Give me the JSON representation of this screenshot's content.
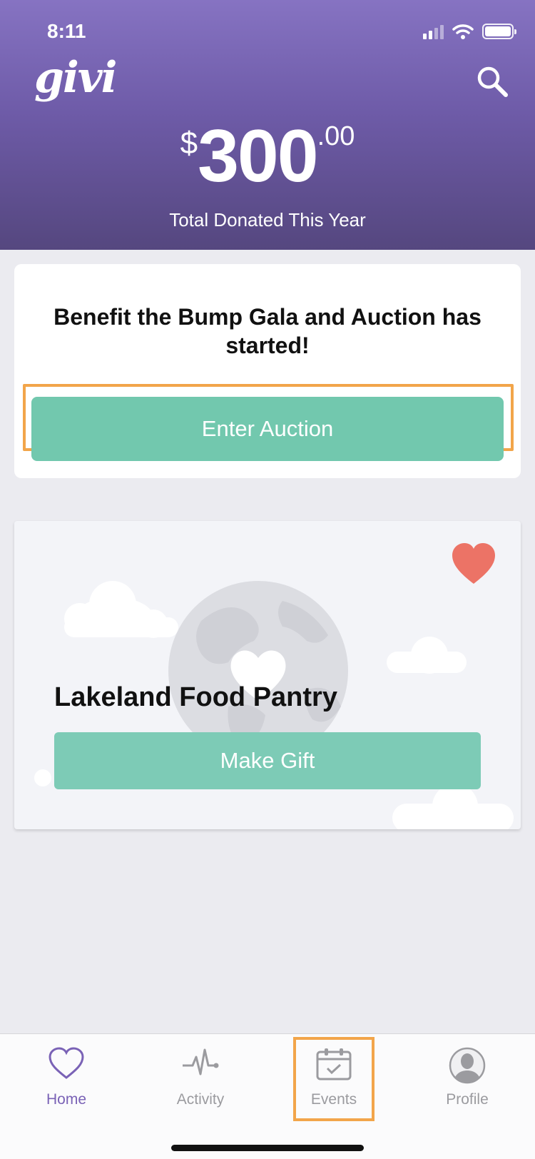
{
  "status_bar": {
    "time": "8:11"
  },
  "header": {
    "logo": "givi",
    "currency_symbol": "$",
    "amount_whole": "300",
    "amount_cents": ".00",
    "total_label": "Total Donated This Year"
  },
  "notice": {
    "title": "Benefit the Bump Gala and Auction has started!",
    "button_label": "Enter Auction"
  },
  "charity": {
    "name": "Lakeland Food Pantry",
    "button_label": "Make Gift",
    "favorite_icon": "heart-icon",
    "favorite_color": "#ec7366"
  },
  "tabbar": {
    "tabs": [
      {
        "label": "Home",
        "icon": "heart-outline-icon",
        "active": true
      },
      {
        "label": "Activity",
        "icon": "pulse-icon",
        "active": false
      },
      {
        "label": "Events",
        "icon": "calendar-check-icon",
        "active": false
      },
      {
        "label": "Profile",
        "icon": "person-icon",
        "active": false
      }
    ]
  },
  "colors": {
    "brand_purple": "#7a62b6",
    "accent_green": "#72c8ae",
    "highlight_orange": "#f2a54a"
  }
}
